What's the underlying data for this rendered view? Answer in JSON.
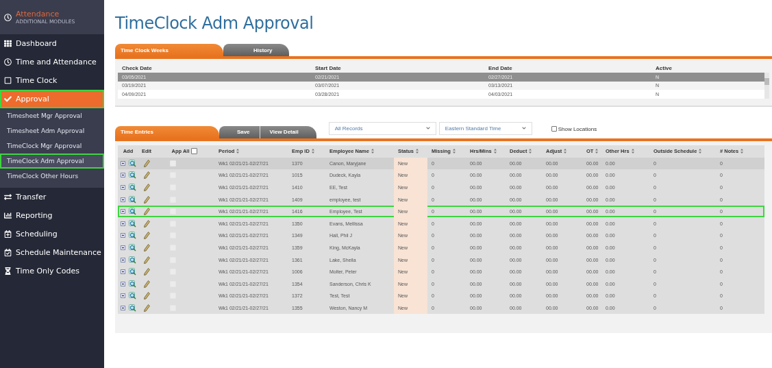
{
  "sidebar": {
    "module": {
      "title": "Attendance",
      "subtitle": "ADDITIONAL MODULES"
    },
    "items": [
      {
        "kind": "main",
        "label": "Dashboard",
        "selected": false,
        "highlighted": false
      },
      {
        "kind": "main",
        "label": "Time and Attendance",
        "selected": false,
        "highlighted": false
      },
      {
        "kind": "main",
        "label": "Time Clock",
        "selected": false,
        "highlighted": false
      },
      {
        "kind": "main",
        "label": "Approval",
        "selected": true,
        "highlighted": true
      },
      {
        "kind": "sub",
        "label": "Timesheet Mgr Approval",
        "selected": false,
        "highlighted": false
      },
      {
        "kind": "sub",
        "label": "Timesheet Adm Approval",
        "selected": false,
        "highlighted": false
      },
      {
        "kind": "sub",
        "label": "TimeClock Mgr Approval",
        "selected": false,
        "highlighted": false
      },
      {
        "kind": "sub",
        "label": "TimeClock Adm Approval",
        "selected": true,
        "highlighted": true
      },
      {
        "kind": "sub",
        "label": "TimeClock Other Hours",
        "selected": false,
        "highlighted": false
      },
      {
        "kind": "main",
        "label": "Transfer",
        "selected": false,
        "highlighted": false
      },
      {
        "kind": "main",
        "label": "Reporting",
        "selected": false,
        "highlighted": false
      },
      {
        "kind": "main",
        "label": "Scheduling",
        "selected": false,
        "highlighted": false
      },
      {
        "kind": "main",
        "label": "Schedule Maintenance",
        "selected": false,
        "highlighted": false
      },
      {
        "kind": "main",
        "label": "Time Only Codes",
        "selected": false,
        "highlighted": false
      }
    ]
  },
  "page_title": "TimeClock Adm Approval",
  "weeks": {
    "tabs": [
      {
        "label": "Time Clock Weeks",
        "selected": true
      },
      {
        "label": "History",
        "selected": false
      }
    ],
    "columns": [
      "Check Date",
      "Start Date",
      "End Date",
      "Active"
    ],
    "rows": [
      {
        "cells": [
          "03/05/2021",
          "02/21/2021",
          "02/27/2021",
          "N"
        ],
        "selected": true
      },
      {
        "cells": [
          "03/19/2021",
          "03/07/2021",
          "03/13/2021",
          "N"
        ],
        "selected": false
      },
      {
        "cells": [
          "04/09/2021",
          "03/28/2021",
          "04/03/2021",
          "N"
        ],
        "selected": false
      }
    ]
  },
  "entries": {
    "tabs": [
      {
        "label": "Time Entries",
        "selected": true
      }
    ],
    "buttons": [
      "Save",
      "View Detail"
    ],
    "filters": [
      {
        "value": "All Records"
      },
      {
        "value": "Eastern Standard Time"
      }
    ],
    "show_locations": {
      "label": "Show Locations",
      "checked": false
    },
    "action_columns": [
      "Add",
      "Edit",
      "App All"
    ],
    "columns": [
      "Period",
      "Emp ID",
      "Employee Name",
      "Status",
      "Missing",
      "Hrs/Mins",
      "Deduct",
      "Adjust",
      "OT",
      "Other Hrs",
      "Outside Schedule",
      "# Notes"
    ],
    "app_all_checked": false,
    "rows": [
      {
        "selected": true,
        "highlighted": false,
        "approved": false,
        "cells": [
          "Wk1 02/21/21-02/27/21",
          "1370",
          "Canon, Maryjane",
          "New",
          "0",
          "00.00",
          "00.00",
          "00.00",
          "00.00",
          "0.00",
          "0",
          "0"
        ]
      },
      {
        "selected": false,
        "highlighted": false,
        "approved": false,
        "cells": [
          "Wk1 02/21/21-02/27/21",
          "1015",
          "Dudeck, Kayla",
          "New",
          "0",
          "00.00",
          "00.00",
          "00.00",
          "00.00",
          "0.00",
          "0",
          "0"
        ]
      },
      {
        "selected": false,
        "highlighted": false,
        "approved": false,
        "cells": [
          "Wk1 02/21/21-02/27/21",
          "1410",
          "EE, Test",
          "New",
          "0",
          "00.00",
          "00.00",
          "00.00",
          "00.00",
          "0.00",
          "0",
          "0"
        ]
      },
      {
        "selected": false,
        "highlighted": false,
        "approved": false,
        "cells": [
          "Wk1 02/21/21-02/27/21",
          "1409",
          "employee, test",
          "New",
          "0",
          "00.00",
          "00.00",
          "00.00",
          "00.00",
          "0.00",
          "0",
          "0"
        ]
      },
      {
        "selected": false,
        "highlighted": true,
        "approved": false,
        "cells": [
          "Wk1 02/21/21-02/27/21",
          "1416",
          "Employee, Test",
          "New",
          "0",
          "00.00",
          "00.00",
          "00.00",
          "00.00",
          "0.00",
          "0",
          "0"
        ]
      },
      {
        "selected": false,
        "highlighted": false,
        "approved": false,
        "cells": [
          "Wk1 02/21/21-02/27/21",
          "1350",
          "Evans, Mellissa",
          "New",
          "0",
          "00.00",
          "00.00",
          "00.00",
          "00.00",
          "0.00",
          "0",
          "0"
        ]
      },
      {
        "selected": false,
        "highlighted": false,
        "approved": false,
        "cells": [
          "Wk1 02/21/21-02/27/21",
          "1349",
          "Hall, Phil J",
          "New",
          "0",
          "00.00",
          "00.00",
          "00.00",
          "00.00",
          "0.00",
          "0",
          "0"
        ]
      },
      {
        "selected": false,
        "highlighted": false,
        "approved": false,
        "cells": [
          "Wk1 02/21/21-02/27/21",
          "1359",
          "King, McKayla",
          "New",
          "0",
          "00.00",
          "00.00",
          "00.00",
          "00.00",
          "0.00",
          "0",
          "0"
        ]
      },
      {
        "selected": false,
        "highlighted": false,
        "approved": false,
        "cells": [
          "Wk1 02/21/21-02/27/21",
          "1361",
          "Lake, Sheila",
          "New",
          "0",
          "00.00",
          "00.00",
          "00.00",
          "00.00",
          "0.00",
          "0",
          "0"
        ]
      },
      {
        "selected": false,
        "highlighted": false,
        "approved": false,
        "cells": [
          "Wk1 02/21/21-02/27/21",
          "1006",
          "Molter, Peter",
          "New",
          "0",
          "00.00",
          "00.00",
          "00.00",
          "00.00",
          "0.00",
          "0",
          "0"
        ]
      },
      {
        "selected": false,
        "highlighted": false,
        "approved": false,
        "cells": [
          "Wk1 02/21/21-02/27/21",
          "1354",
          "Sanderson, Chris K",
          "New",
          "0",
          "00.00",
          "00.00",
          "00.00",
          "00.00",
          "0.00",
          "0",
          "0"
        ]
      },
      {
        "selected": false,
        "highlighted": false,
        "approved": false,
        "cells": [
          "Wk1 02/21/21-02/27/21",
          "1372",
          "Test, Test",
          "New",
          "0",
          "00.00",
          "00.00",
          "00.00",
          "00.00",
          "0.00",
          "0",
          "0"
        ]
      },
      {
        "selected": false,
        "highlighted": false,
        "approved": false,
        "cells": [
          "Wk1 02/21/21-02/27/21",
          "1355",
          "Weston, Nancy M",
          "New",
          "0",
          "00.00",
          "00.00",
          "00.00",
          "00.00",
          "0.00",
          "0",
          "0"
        ]
      }
    ]
  }
}
